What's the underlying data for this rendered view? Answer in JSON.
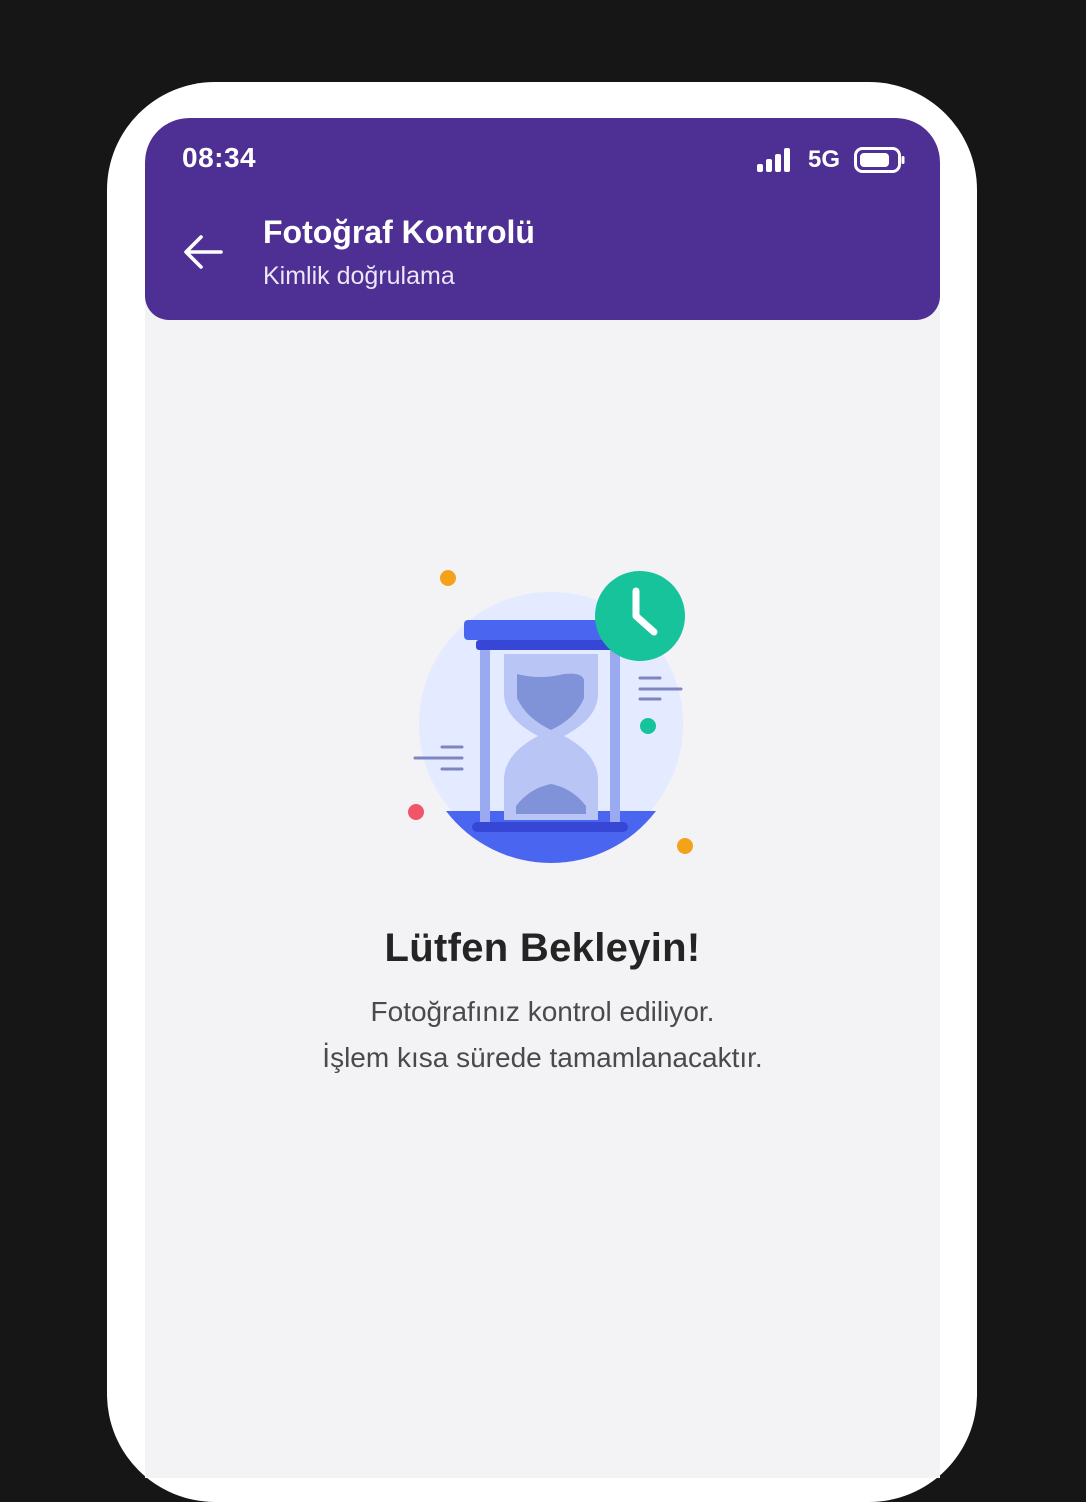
{
  "status_bar": {
    "time": "08:34",
    "network": "5G",
    "icons": [
      "signal-icon",
      "battery-icon"
    ]
  },
  "header": {
    "title": "Fotoğraf Kontrolü",
    "subtitle": "Kimlik doğrulama",
    "back_icon": "arrow-left-icon"
  },
  "content": {
    "heading": "Lütfen Bekleyin!",
    "line_1": "Fotoğrafınız kontrol ediliyor.",
    "line_2": "İşlem kısa sürede tamamlanacaktır.",
    "illustration": "hourglass-clock-illustration"
  },
  "colors": {
    "header": "#4e2f93",
    "background": "#f3f3f5",
    "accent_blue": "#4a66f0",
    "accent_green": "#16c39a",
    "accent_orange": "#f5a21b",
    "accent_red": "#f0566a"
  }
}
